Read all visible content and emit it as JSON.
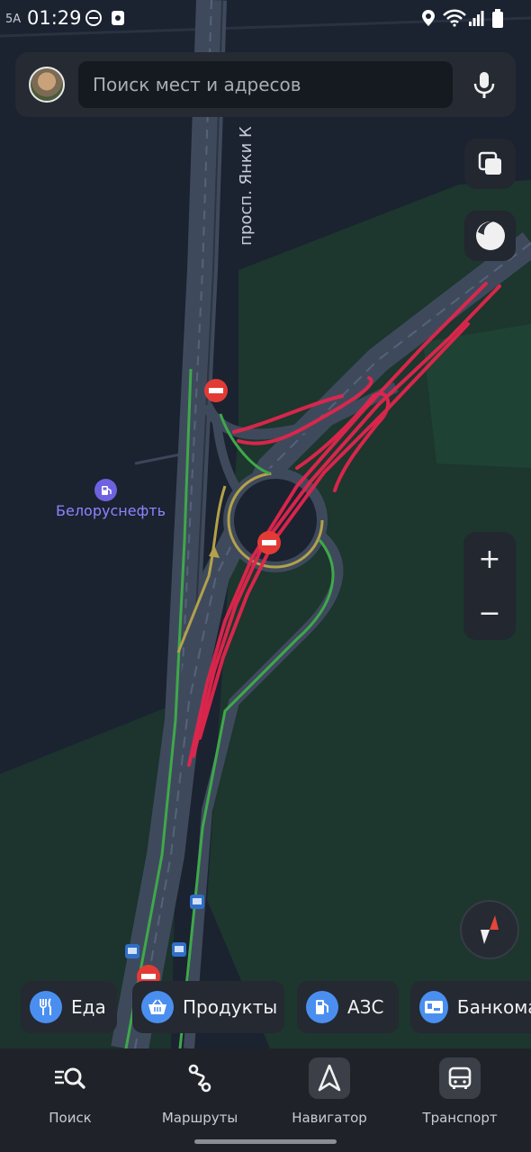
{
  "status_bar": {
    "time": "01:29",
    "left_small": "5A",
    "icons": [
      "dnd-icon",
      "notification-icon",
      "location-icon",
      "wifi-icon",
      "signal-icon",
      "battery-icon"
    ]
  },
  "search": {
    "placeholder": "Поиск мест и адресов"
  },
  "map": {
    "street_label": "просп. Янки К",
    "poi_name": "Белоруснефть",
    "colors": {
      "background": "#1b2230",
      "park": "#1d3a2e",
      "road": "#4a5568",
      "traffic_green": "#3fa84a",
      "traffic_yellow": "#b3a24a",
      "drawn_red": "#e2264d",
      "poi": "#8e84ff"
    }
  },
  "zoom": {
    "in": "+",
    "out": "−"
  },
  "chips": [
    {
      "label": "Еда",
      "icon": "fork-knife-icon"
    },
    {
      "label": "Продукты",
      "icon": "basket-icon"
    },
    {
      "label": "АЗС",
      "icon": "fuel-icon"
    },
    {
      "label": "Банкоматы",
      "icon": "atm-icon"
    }
  ],
  "tabs": [
    {
      "label": "Поиск",
      "icon": "search-list-icon"
    },
    {
      "label": "Маршруты",
      "icon": "routes-icon"
    },
    {
      "label": "Навигатор",
      "icon": "navigator-arrow-icon"
    },
    {
      "label": "Транспорт",
      "icon": "bus-icon"
    }
  ]
}
